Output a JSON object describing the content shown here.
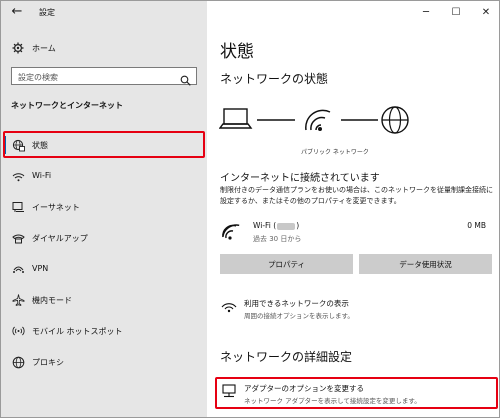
{
  "window": {
    "title": "設定",
    "back_icon": "back-arrow-icon",
    "controls": [
      "minimize",
      "maximize",
      "close"
    ]
  },
  "sidebar": {
    "home_label": "ホーム",
    "search_placeholder": "設定の検索",
    "section_heading": "ネットワークとインターネット",
    "items": [
      {
        "label": "状態",
        "icon": "globe-status-icon",
        "selected": true
      },
      {
        "label": "Wi-Fi",
        "icon": "wifi-icon"
      },
      {
        "label": "イーサネット",
        "icon": "ethernet-icon"
      },
      {
        "label": "ダイヤルアップ",
        "icon": "dialup-icon"
      },
      {
        "label": "VPN",
        "icon": "vpn-icon"
      },
      {
        "label": "機内モード",
        "icon": "airplane-icon"
      },
      {
        "label": "モバイル ホットスポット",
        "icon": "hotspot-icon"
      },
      {
        "label": "プロキシ",
        "icon": "globe-icon"
      }
    ]
  },
  "main": {
    "title": "状態",
    "network_status_heading": "ネットワークの状態",
    "network_caption": "パブリック ネットワーク",
    "connected_title": "インターネットに接続されています",
    "connected_desc": "制限付きのデータ通信プランをお使いの場合は、このネットワークを従量制課金接続に設定するか、またはその他のプロパティを変更できます。",
    "wifi_name_prefix": "Wi-Fi (",
    "wifi_name_suffix": ")",
    "wifi_sub": "過去 30 日から",
    "wifi_usage": "0 MB",
    "properties_button": "プロパティ",
    "data_usage_button": "データ使用状況",
    "show_networks_title": "利用できるネットワークの表示",
    "show_networks_desc": "周囲の接続オプションを表示します。",
    "advanced_heading": "ネットワークの詳細設定",
    "adapter_title": "アダプターのオプションを変更する",
    "adapter_desc": "ネットワーク アダプターを表示して接続設定を変更します。"
  },
  "colors": {
    "sidebar_bg": "#e6e6e6",
    "accent": "#0063b1",
    "highlight": "#e60012",
    "button_bg": "#cccccc"
  }
}
